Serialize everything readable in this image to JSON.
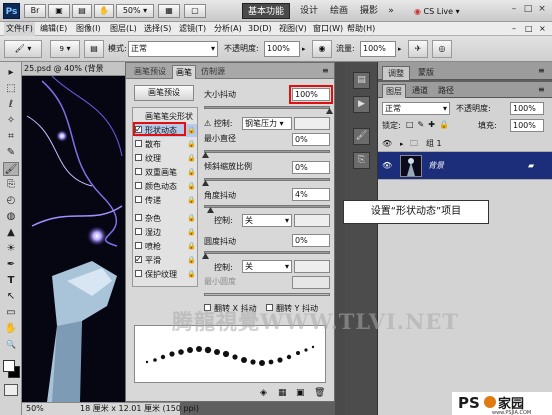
{
  "titlebar": {
    "app_badge": "Ps",
    "zoom": "50%",
    "workspaces": {
      "active": "基本功能",
      "items": [
        "设计",
        "绘画",
        "摄影"
      ]
    },
    "more": "»",
    "cs_live": "CS Live",
    "window_controls": [
      "–",
      "□",
      "×"
    ]
  },
  "menubar": {
    "items": [
      "文件(F)",
      "编辑(E)",
      "图像(I)",
      "图层(L)",
      "选择(S)",
      "滤镜(T)",
      "分析(A)",
      "3D(D)",
      "视图(V)",
      "窗口(W)",
      "帮助(H)"
    ],
    "right_controls": [
      "–",
      "□",
      "×"
    ]
  },
  "options_bar": {
    "brush_size": "9",
    "mode_label": "模式:",
    "mode_value": "正常",
    "opacity_label": "不透明度:",
    "opacity_value": "100%",
    "flow_label": "流量:",
    "flow_value": "100%"
  },
  "tools": [
    "▸",
    "⬚",
    "ℓ",
    "✧",
    "⌗",
    "✎",
    "🖌",
    "⎘",
    "◴",
    "◍",
    "▲",
    "☀",
    "✒",
    "T",
    "↖",
    "▭",
    "✋",
    "🔍"
  ],
  "document": {
    "tab_title": "25.psd @ 40% (背景",
    "status_zoom": "50%",
    "status_info": "18 厘米 x 12.01 厘米 (150 ppi)"
  },
  "brush_panel": {
    "tabs": [
      "画笔预设",
      "画笔",
      "仿制源"
    ],
    "active_tab": "画笔",
    "preset_button": "画笔预设",
    "options_header": "画笔笔尖形状",
    "options": [
      {
        "label": "形状动态",
        "checked": true,
        "selected": true
      },
      {
        "label": "散布",
        "checked": false
      },
      {
        "label": "纹理",
        "checked": false
      },
      {
        "label": "双重画笔",
        "checked": false
      },
      {
        "label": "颜色动态",
        "checked": false
      },
      {
        "label": "传递",
        "checked": false
      },
      {
        "label": "杂色",
        "checked": false
      },
      {
        "label": "湿边",
        "checked": false
      },
      {
        "label": "喷枪",
        "checked": false
      },
      {
        "label": "平滑",
        "checked": true
      },
      {
        "label": "保护纹理",
        "checked": false
      }
    ],
    "size_jitter_label": "大小抖动",
    "size_jitter_value": "100%",
    "control_label": "控制:",
    "size_control_value": "钢笔压力",
    "min_diameter_label": "最小直径",
    "min_diameter_value": "0%",
    "tilt_scale_label": "倾斜缩放比例",
    "tilt_scale_value": "0%",
    "angle_jitter_label": "角度抖动",
    "angle_jitter_value": "4%",
    "angle_control_value": "关",
    "roundness_jitter_label": "圆度抖动",
    "roundness_jitter_value": "0%",
    "roundness_control_value": "关",
    "min_roundness_label": "最小圆度",
    "flip_x_label": "翻转 X 抖动",
    "flip_y_label": "翻转 Y 抖动"
  },
  "adjust_panel": {
    "tabs": [
      "调整",
      "蒙版"
    ]
  },
  "layers_panel": {
    "tabs": [
      "图层",
      "通道",
      "路径"
    ],
    "blend_mode": "正常",
    "opacity_label": "不透明度:",
    "opacity_value": "100%",
    "lock_label": "锁定:",
    "fill_label": "填充:",
    "fill_value": "100%",
    "layers": [
      {
        "name": "组 1",
        "kind": "group",
        "selected": false
      },
      {
        "name": "背景",
        "kind": "image",
        "selected": true
      }
    ]
  },
  "annotation": {
    "callout_text": "设置“形状动态”项目"
  },
  "watermark": {
    "text": "腾龍視覺WWW.TLVI.NET"
  },
  "site_logo": {
    "text_ps": "PS",
    "text_cn": "家园",
    "url": "www.PSJIA.COM"
  }
}
